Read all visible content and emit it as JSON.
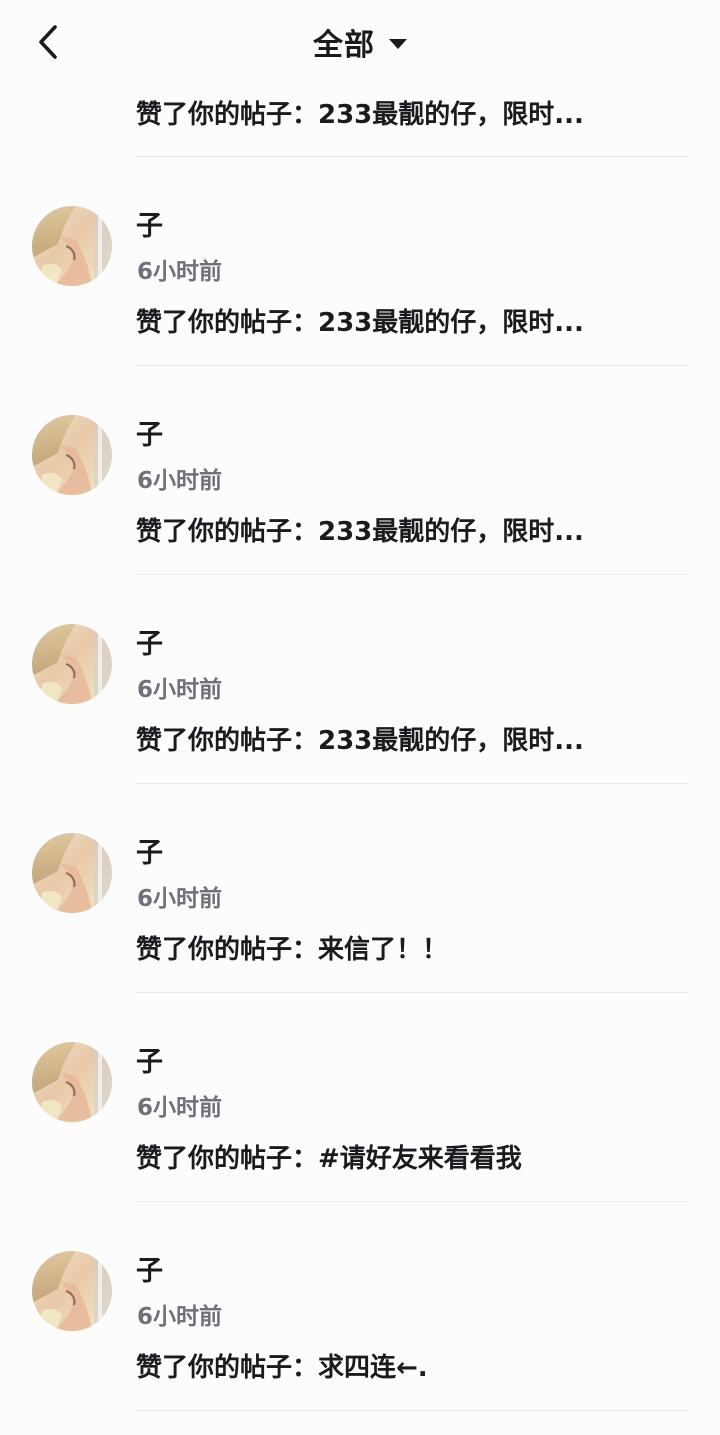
{
  "header": {
    "title": "全部"
  },
  "partial_item": {
    "message": "赞了你的帖子：233最靓的仔，限时..."
  },
  "items": [
    {
      "name": "子",
      "time": "6小时前",
      "message": "赞了你的帖子：233最靓的仔，限时..."
    },
    {
      "name": "子",
      "time": "6小时前",
      "message": "赞了你的帖子：233最靓的仔，限时..."
    },
    {
      "name": "子",
      "time": "6小时前",
      "message": "赞了你的帖子：233最靓的仔，限时..."
    },
    {
      "name": "子",
      "time": "6小时前",
      "message": "赞了你的帖子：来信了！！"
    },
    {
      "name": "子",
      "time": "6小时前",
      "message": "赞了你的帖子：#请好友来看看我"
    },
    {
      "name": "子",
      "time": "6小时前",
      "message": "赞了你的帖子：求四连←."
    }
  ],
  "colors": {
    "background": "#fcfcfd",
    "text_primary": "#1b1b1f",
    "text_secondary": "#707078",
    "divider": "#ececef"
  },
  "icons": {
    "back": "chevron-left-icon",
    "dropdown": "caret-down-icon"
  }
}
